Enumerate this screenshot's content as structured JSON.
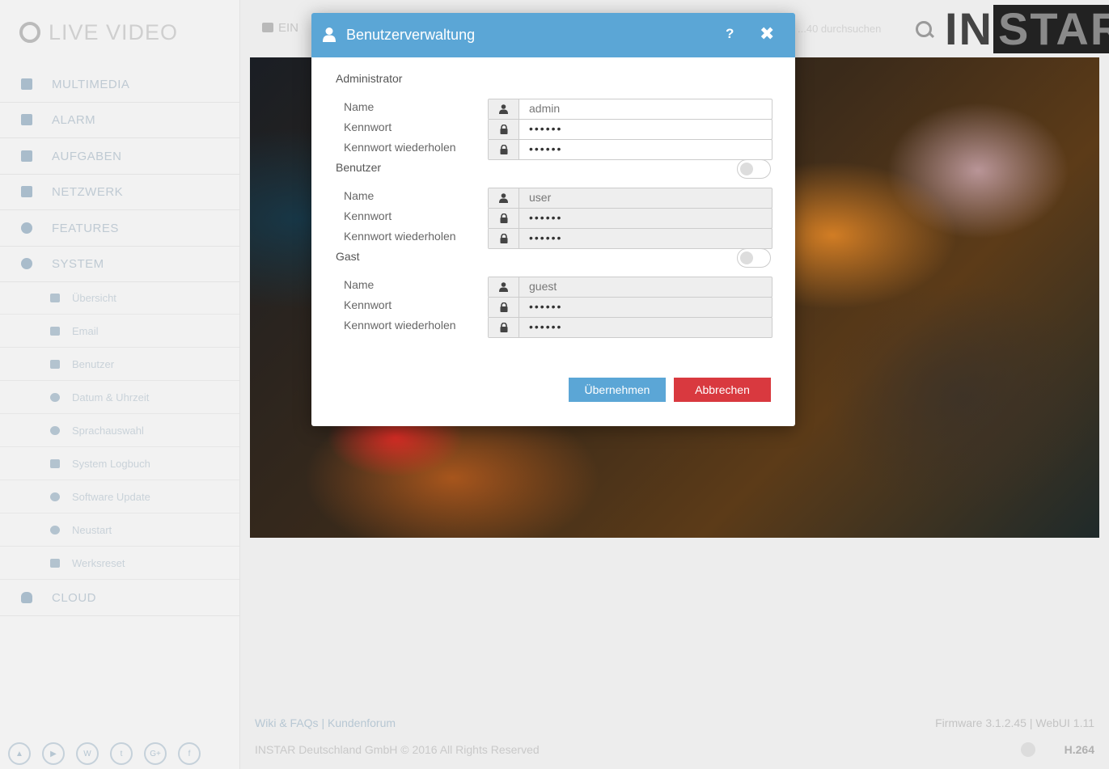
{
  "app": {
    "brand": "LIVE VIDEO",
    "logo_left": "IN",
    "logo_right": "STAR",
    "topbar_button": "EIN",
    "search_placeholder": "...40 durchsuchen"
  },
  "sidebar": {
    "items": [
      {
        "label": "MULTIMEDIA"
      },
      {
        "label": "ALARM"
      },
      {
        "label": "AUFGABEN"
      },
      {
        "label": "NETZWERK"
      },
      {
        "label": "FEATURES"
      },
      {
        "label": "SYSTEM"
      }
    ],
    "system_sub": [
      {
        "label": "Übersicht"
      },
      {
        "label": "Email"
      },
      {
        "label": "Benutzer"
      },
      {
        "label": "Datum & Uhrzeit"
      },
      {
        "label": "Sprachauswahl"
      },
      {
        "label": "System Logbuch"
      },
      {
        "label": "Software Update"
      },
      {
        "label": "Neustart"
      },
      {
        "label": "Werksreset"
      }
    ],
    "cloud": "CLOUD",
    "social": [
      "▲",
      "▶",
      "W",
      "t",
      "G+",
      "f"
    ]
  },
  "footer": {
    "links": "Wiki & FAQs | Kundenforum",
    "copyright": "INSTAR Deutschland GmbH © 2016 All Rights Reserved",
    "firmware": "Firmware 3.1.2.45 | WebUI 1.11",
    "codec": "H.264"
  },
  "modal": {
    "title": "Benutzerverwaltung",
    "help": "?",
    "close": "✖",
    "admin": {
      "section": "Administrator",
      "name_label": "Name",
      "name_value": "admin",
      "password_label": "Kennwort",
      "password_value": "aaaaaa",
      "repeat_label": "Kennwort wiederholen",
      "repeat_value": "aaaaaa"
    },
    "user": {
      "section": "Benutzer",
      "enabled": false,
      "name_label": "Name",
      "name_value": "user",
      "password_label": "Kennwort",
      "password_value": "aaaaaa",
      "repeat_label": "Kennwort wiederholen",
      "repeat_value": "aaaaaa"
    },
    "guest": {
      "section": "Gast",
      "enabled": false,
      "name_label": "Name",
      "name_value": "guest",
      "password_label": "Kennwort",
      "password_value": "aaaaaa",
      "repeat_label": "Kennwort wiederholen",
      "repeat_value": "aaaaaa"
    },
    "save_label": "Übernehmen",
    "cancel_label": "Abbrechen"
  },
  "colors": {
    "header": "#5ba6d6",
    "save": "#5ba6d6",
    "cancel": "#d9393f"
  }
}
